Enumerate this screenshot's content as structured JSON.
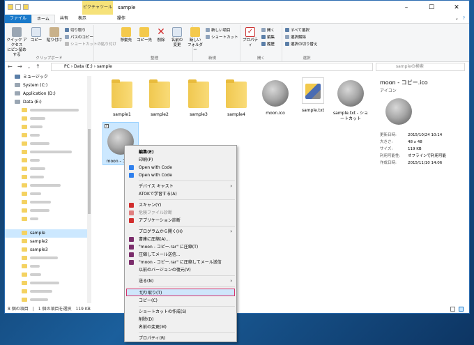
{
  "window": {
    "title": "sample",
    "context_tab": "ピクチャツール"
  },
  "tabs": {
    "file": "ファイル",
    "home": "ホーム",
    "share": "共有",
    "view": "表示",
    "manage": "操作"
  },
  "ribbon": {
    "pin": "クイック アクセス\nにピン留めする",
    "copy": "コピー",
    "paste": "貼り付け",
    "cut": "切り取り",
    "copy_path": "パスのコピー",
    "paste_shortcut": "ショートカットの貼り付け",
    "group_clipboard": "クリップボード",
    "move_to": "移動先",
    "copy_to": "コピー先",
    "delete": "削除",
    "rename": "名前の\n変更",
    "group_organize": "整理",
    "new_folder": "新しい\nフォルダー",
    "new_item": "新しい項目",
    "shortcut": "ショートカット",
    "group_new": "新規",
    "properties": "プロパティ",
    "open": "開く",
    "edit": "編集",
    "history": "履歴",
    "group_open": "開く",
    "select_all": "すべて選択",
    "select_none": "選択解除",
    "invert": "選択の切り替え",
    "group_select": "選択"
  },
  "address": {
    "path": "PC  ›  Data (E:)  ›  sample",
    "search_placeholder": "sampleの検索"
  },
  "nav": {
    "music": "ミュージック",
    "system": "System (C:)",
    "application": "Application (D:)",
    "data": "Data (E:)",
    "sample": "sample",
    "sample2": "sample2",
    "sample3": "sample3"
  },
  "files": [
    {
      "name": "sample1",
      "kind": "folder"
    },
    {
      "name": "sample2",
      "kind": "folder"
    },
    {
      "name": "sample3",
      "kind": "folder"
    },
    {
      "name": "sample4",
      "kind": "folder"
    },
    {
      "name": "moon.ico",
      "kind": "moon"
    },
    {
      "name": "sample.txt",
      "kind": "txt"
    },
    {
      "name": "sample.txt - ショートカット",
      "kind": "moon"
    },
    {
      "name": "moon - コピ...",
      "kind": "moon"
    }
  ],
  "preview": {
    "name": "moon - コピー.ico",
    "type": "アイコン",
    "rows": [
      {
        "k": "更新日時:",
        "v": "2015/10/24 10:14"
      },
      {
        "k": "大きさ:",
        "v": "48 x 48"
      },
      {
        "k": "サイズ:",
        "v": "119 KB"
      },
      {
        "k": "利用可能性:",
        "v": "オフラインで利用可能"
      },
      {
        "k": "作成日時:",
        "v": "2015/11/10 14:06"
      }
    ]
  },
  "status": "8 個の項目　|　1 個の項目を選択　119 KB",
  "menu": {
    "open": "編集(E)",
    "print": "印刷(P)",
    "open_with_code1": "Open with Code",
    "open_with_code2": "Open with Code",
    "device_cast": "デバイス キャスト",
    "atok": "ATOKで学習する(A)",
    "scan": "スキャン(Y)",
    "danger": "危険ファイル診断",
    "app_diag": "アプリケーション診断",
    "open_with": "プログラムから開く(H)",
    "compress1": "書庫に圧縮(A)...",
    "compress2": "\"moon - コピー.rar\" に圧縮(T)",
    "compress_mail": "圧縮してメール送信...",
    "compress_mail2": "\"moon - コピー.rar\" に圧縮してメール送信",
    "restore": "以前のバージョンの復元(V)",
    "send_to": "送る(N)",
    "cut": "切り取り(T)",
    "copy": "コピー(C)",
    "create_shortcut": "ショートカットの作成(S)",
    "delete": "削除(D)",
    "rename": "名前の変更(M)",
    "properties": "プロパティ(R)"
  }
}
